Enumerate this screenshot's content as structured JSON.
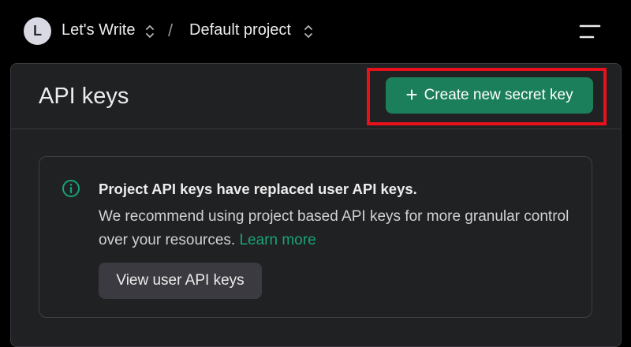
{
  "topbar": {
    "avatar_initial": "L",
    "org_name": "Let's Write",
    "separator": "/",
    "project_name": "Default project"
  },
  "page": {
    "title": "API keys",
    "create_button_label": "Create new secret key",
    "create_button_icon": "plus-icon"
  },
  "notice": {
    "icon": "info-circle-icon",
    "title": "Project API keys have replaced user API keys.",
    "body": "We recommend using project based API keys for more granular control over your resources.",
    "link_label": "Learn more",
    "button_label": "View user API keys"
  },
  "colors": {
    "background": "#000000",
    "panel": "#202123",
    "accent_green": "#1a7f5a",
    "link_green": "#19a37a",
    "highlight_red": "#e8101a"
  }
}
